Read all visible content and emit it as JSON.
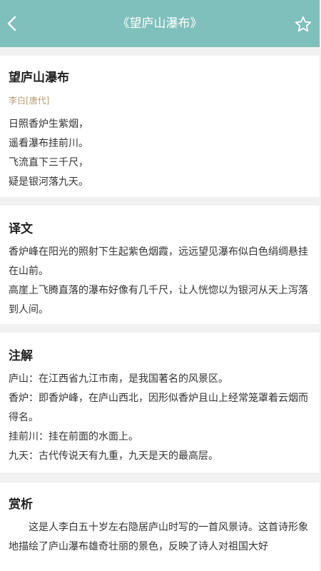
{
  "header": {
    "title": "《望庐山瀑布》",
    "accent": "#7fbfbc"
  },
  "poem": {
    "title": "望庐山瀑布",
    "author": "李白[唐代]",
    "lines": [
      "日照香炉生紫烟，",
      "遥看瀑布挂前川。",
      "飞流直下三千尺，",
      "疑是银河落九天。"
    ]
  },
  "translation": {
    "heading": "译文",
    "paragraphs": [
      "香炉峰在阳光的照射下生起紫色烟霞，远远望见瀑布似白色绢绸悬挂在山前。",
      "高崖上飞腾直落的瀑布好像有几千尺，让人恍惚以为银河从天上泻落到人间。"
    ]
  },
  "notes": {
    "heading": "注解",
    "items": [
      "庐山：在江西省九江市南，是我国著名的风景区。",
      "香炉：即香炉峰，在庐山西北，因形似香炉且山上经常笼罩着云烟而得名。",
      "挂前川：挂在前面的水面上。",
      "九天：古代传说天有九重，九天是天的最高层。"
    ]
  },
  "appreciation": {
    "heading": "赏析",
    "text": "这是人李白五十岁左右隐居庐山时写的一首风景诗。这首诗形象地描绘了庐山瀑布雄奇壮丽的景色，反映了诗人对祖国大好"
  }
}
